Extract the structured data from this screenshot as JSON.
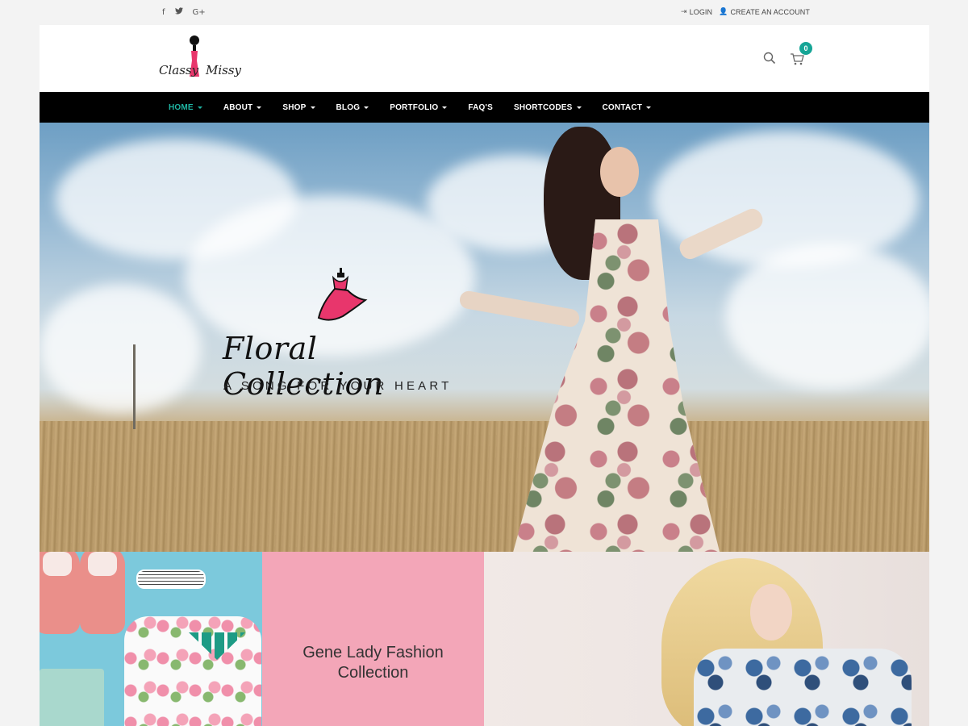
{
  "topbar": {
    "social": [
      {
        "icon": "facebook-icon",
        "glyph": "f"
      },
      {
        "icon": "twitter-icon",
        "glyph": "🐦"
      },
      {
        "icon": "google-plus-icon",
        "glyph": "G+"
      }
    ],
    "login_label": "LOGIN",
    "create_account_label": "CREATE AN ACCOUNT"
  },
  "header": {
    "logo_word1": "Classy",
    "logo_word2": "Missy",
    "cart_count": "0"
  },
  "nav": {
    "items": [
      {
        "label": "HOME",
        "dropdown": true,
        "active": true
      },
      {
        "label": "ABOUT",
        "dropdown": true
      },
      {
        "label": "SHOP",
        "dropdown": true
      },
      {
        "label": "BLOG",
        "dropdown": true
      },
      {
        "label": "PORTFOLIO",
        "dropdown": true
      },
      {
        "label": "FAQ'S",
        "dropdown": false
      },
      {
        "label": "SHORTCODES",
        "dropdown": true
      },
      {
        "label": "CONTACT",
        "dropdown": true
      }
    ]
  },
  "hero": {
    "title": "Floral Collection",
    "subtitle": "A SONG FOR YOUR HEART"
  },
  "promo": {
    "title_line1": "Gene Lady Fashion",
    "title_line2": "Collection"
  },
  "colors": {
    "accent": "#16a596",
    "nav_bg": "#000000",
    "brand_pink": "#e8366c",
    "promo_pink": "#f3a6b8"
  }
}
